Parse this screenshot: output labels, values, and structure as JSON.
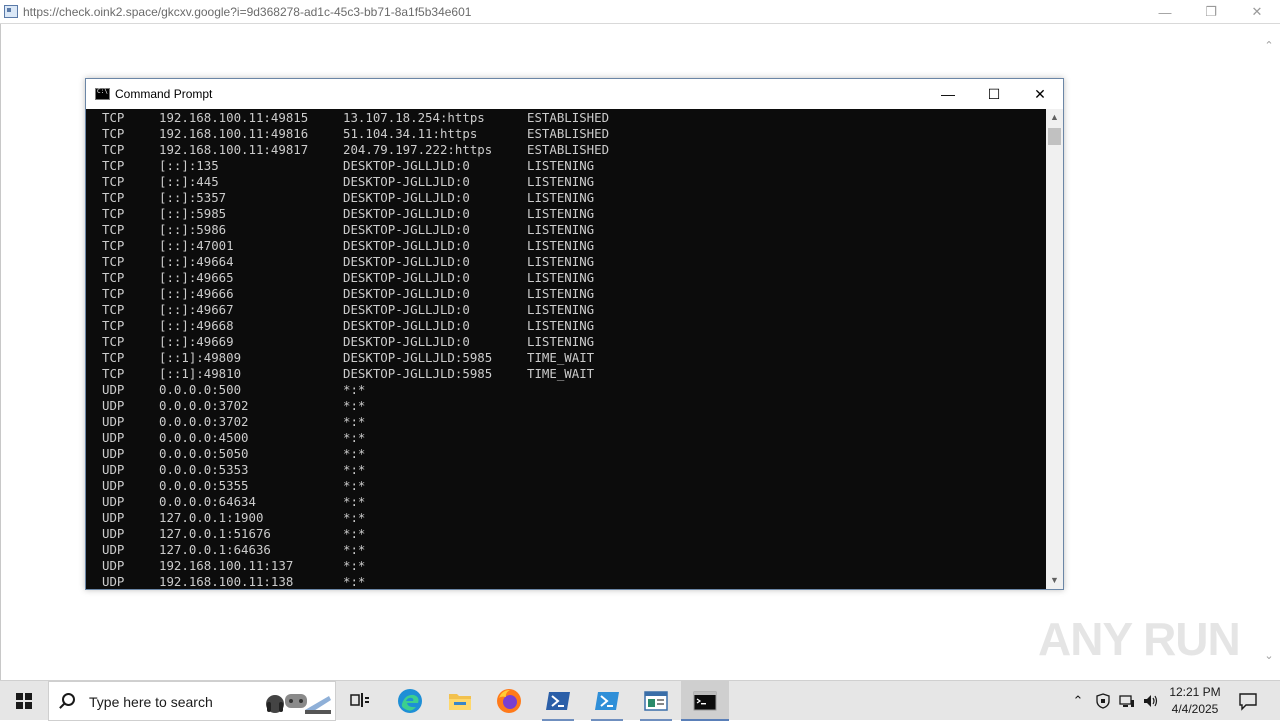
{
  "browser": {
    "url": "https://check.oink2.space/gkcxv.google?i=9d368278-ad1c-45c3-bb71-8a1f5b34e601"
  },
  "cmd": {
    "title": "Command Prompt",
    "lines": [
      {
        "proto": "TCP",
        "local": "192.168.100.11:49815",
        "foreign": "13.107.18.254:https",
        "state": "ESTABLISHED"
      },
      {
        "proto": "TCP",
        "local": "192.168.100.11:49816",
        "foreign": "51.104.34.11:https",
        "state": "ESTABLISHED"
      },
      {
        "proto": "TCP",
        "local": "192.168.100.11:49817",
        "foreign": "204.79.197.222:https",
        "state": "ESTABLISHED"
      },
      {
        "proto": "TCP",
        "local": "[::]:135",
        "foreign": "DESKTOP-JGLLJLD:0",
        "state": "LISTENING"
      },
      {
        "proto": "TCP",
        "local": "[::]:445",
        "foreign": "DESKTOP-JGLLJLD:0",
        "state": "LISTENING"
      },
      {
        "proto": "TCP",
        "local": "[::]:5357",
        "foreign": "DESKTOP-JGLLJLD:0",
        "state": "LISTENING"
      },
      {
        "proto": "TCP",
        "local": "[::]:5985",
        "foreign": "DESKTOP-JGLLJLD:0",
        "state": "LISTENING"
      },
      {
        "proto": "TCP",
        "local": "[::]:5986",
        "foreign": "DESKTOP-JGLLJLD:0",
        "state": "LISTENING"
      },
      {
        "proto": "TCP",
        "local": "[::]:47001",
        "foreign": "DESKTOP-JGLLJLD:0",
        "state": "LISTENING"
      },
      {
        "proto": "TCP",
        "local": "[::]:49664",
        "foreign": "DESKTOP-JGLLJLD:0",
        "state": "LISTENING"
      },
      {
        "proto": "TCP",
        "local": "[::]:49665",
        "foreign": "DESKTOP-JGLLJLD:0",
        "state": "LISTENING"
      },
      {
        "proto": "TCP",
        "local": "[::]:49666",
        "foreign": "DESKTOP-JGLLJLD:0",
        "state": "LISTENING"
      },
      {
        "proto": "TCP",
        "local": "[::]:49667",
        "foreign": "DESKTOP-JGLLJLD:0",
        "state": "LISTENING"
      },
      {
        "proto": "TCP",
        "local": "[::]:49668",
        "foreign": "DESKTOP-JGLLJLD:0",
        "state": "LISTENING"
      },
      {
        "proto": "TCP",
        "local": "[::]:49669",
        "foreign": "DESKTOP-JGLLJLD:0",
        "state": "LISTENING"
      },
      {
        "proto": "TCP",
        "local": "[::1]:49809",
        "foreign": "DESKTOP-JGLLJLD:5985",
        "state": "TIME_WAIT"
      },
      {
        "proto": "TCP",
        "local": "[::1]:49810",
        "foreign": "DESKTOP-JGLLJLD:5985",
        "state": "TIME_WAIT"
      },
      {
        "proto": "UDP",
        "local": "0.0.0.0:500",
        "foreign": "*:*",
        "state": ""
      },
      {
        "proto": "UDP",
        "local": "0.0.0.0:3702",
        "foreign": "*:*",
        "state": ""
      },
      {
        "proto": "UDP",
        "local": "0.0.0.0:3702",
        "foreign": "*:*",
        "state": ""
      },
      {
        "proto": "UDP",
        "local": "0.0.0.0:4500",
        "foreign": "*:*",
        "state": ""
      },
      {
        "proto": "UDP",
        "local": "0.0.0.0:5050",
        "foreign": "*:*",
        "state": ""
      },
      {
        "proto": "UDP",
        "local": "0.0.0.0:5353",
        "foreign": "*:*",
        "state": ""
      },
      {
        "proto": "UDP",
        "local": "0.0.0.0:5355",
        "foreign": "*:*",
        "state": ""
      },
      {
        "proto": "UDP",
        "local": "0.0.0.0:64634",
        "foreign": "*:*",
        "state": ""
      },
      {
        "proto": "UDP",
        "local": "127.0.0.1:1900",
        "foreign": "*:*",
        "state": ""
      },
      {
        "proto": "UDP",
        "local": "127.0.0.1:51676",
        "foreign": "*:*",
        "state": ""
      },
      {
        "proto": "UDP",
        "local": "127.0.0.1:64636",
        "foreign": "*:*",
        "state": ""
      },
      {
        "proto": "UDP",
        "local": "192.168.100.11:137",
        "foreign": "*:*",
        "state": ""
      },
      {
        "proto": "UDP",
        "local": "192.168.100.11:138",
        "foreign": "*:*",
        "state": ""
      }
    ]
  },
  "watermark": "ANY RUN",
  "taskbar": {
    "search_placeholder": "Type here to search",
    "items": [
      {
        "name": "task-view-icon",
        "active": false
      },
      {
        "name": "edge-icon",
        "active": false
      },
      {
        "name": "file-explorer-icon",
        "active": false
      },
      {
        "name": "firefox-icon",
        "active": false
      },
      {
        "name": "powershell-icon",
        "active": false
      },
      {
        "name": "powershell-ise-icon",
        "active": false
      },
      {
        "name": "window-app-icon",
        "active": false
      },
      {
        "name": "command-prompt-icon",
        "active": true
      }
    ],
    "time": "12:21 PM",
    "date": "4/4/2025"
  }
}
